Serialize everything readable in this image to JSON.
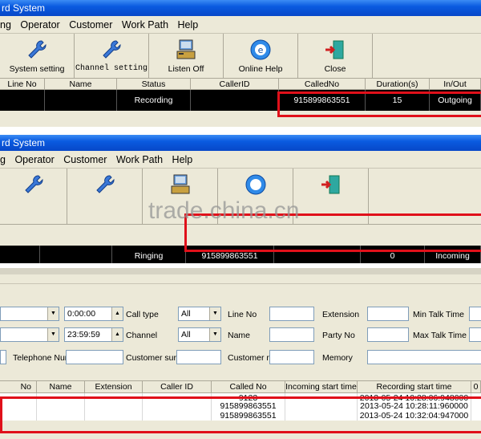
{
  "panel1": {
    "title": "rd System",
    "menu": [
      "ng",
      "Operator",
      "Customer",
      "Work Path",
      "Help"
    ],
    "toolbar": [
      {
        "label": "System setting",
        "icon": "wrench-icon"
      },
      {
        "label": "Channel setting",
        "icon": "wrench-icon"
      },
      {
        "label": "Listen Off",
        "icon": "computer-phone-icon"
      },
      {
        "label": "Online Help",
        "icon": "help-globe-icon"
      },
      {
        "label": "Close",
        "icon": "exit-door-icon"
      }
    ],
    "columns": [
      "Line No",
      "Name",
      "Status",
      "CallerID",
      "CalledNo",
      "Duration(s)",
      "In/Out"
    ],
    "row": {
      "line_no": "",
      "name": "",
      "status": "Recording",
      "caller_id": "",
      "called_no": "915899863551",
      "duration": "15",
      "in_out": "Outgoing"
    }
  },
  "panel2": {
    "title": "rd System",
    "menu": [
      "g",
      "Operator",
      "Customer",
      "Work Path",
      "Help"
    ],
    "row": {
      "status": "Ringing",
      "called_no": "915899863551",
      "duration": "0",
      "in_out": "Incoming"
    }
  },
  "watermark": "trade.china.cn",
  "panel3": {
    "time_start": "0:00:00",
    "time_end": "23:59:59",
    "labels": {
      "call_type": "Call type",
      "channel": "Channel",
      "line_no": "Line No",
      "name": "Name",
      "extension": "Extension",
      "party_no": "Party No",
      "min_talk": "Min Talk Time",
      "max_talk": "Max Talk Time",
      "telephone": "Telephone Nur",
      "customer_surv": "Customer surv",
      "customer_na": "Customer na",
      "memory": "Memory"
    },
    "call_type_value": "All",
    "channel_value": "All",
    "columns": [
      "No",
      "Name",
      "Extension",
      "Caller ID",
      "Called No",
      "Incoming start time",
      "Recording start time",
      "0"
    ],
    "rows": [
      {
        "called_no": "9123",
        "recording_start": "2013-05-24 10:28:06:948000"
      },
      {
        "called_no": "915899863551",
        "recording_start": "2013-05-24 10:28:11:960000"
      },
      {
        "called_no": "915899863551",
        "recording_start": "2013-05-24 10:32:04:947000"
      }
    ]
  }
}
